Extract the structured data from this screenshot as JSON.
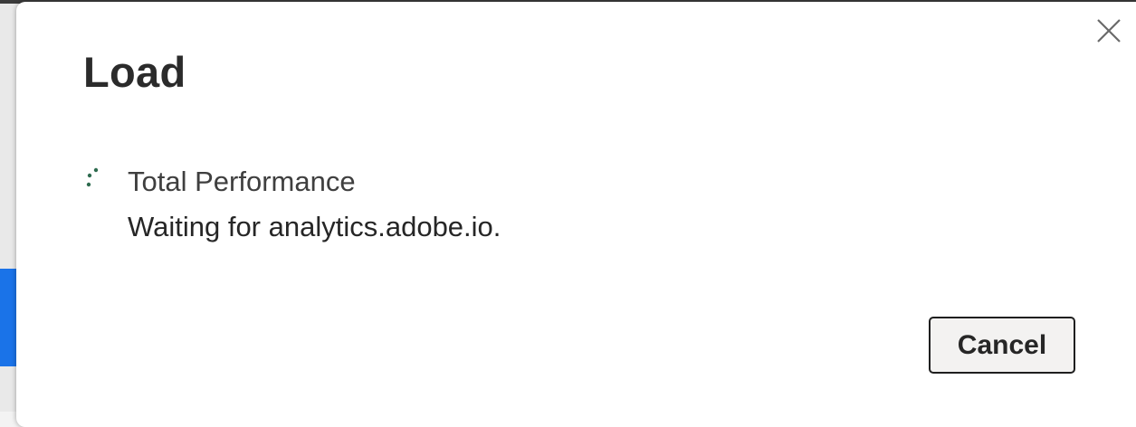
{
  "dialog": {
    "title": "Load",
    "close_icon": "close-icon",
    "item": {
      "spinner_icon": "loading-spinner-icon",
      "name": "Total Performance",
      "status": "Waiting for analytics.adobe.io."
    },
    "cancel_label": "Cancel"
  },
  "colors": {
    "spinner": "#2e6b4f",
    "background_accent": "#1a73e8",
    "title": "#2b2b2b",
    "button_bg": "#f3f2f1",
    "button_border": "#1f1f1f"
  }
}
